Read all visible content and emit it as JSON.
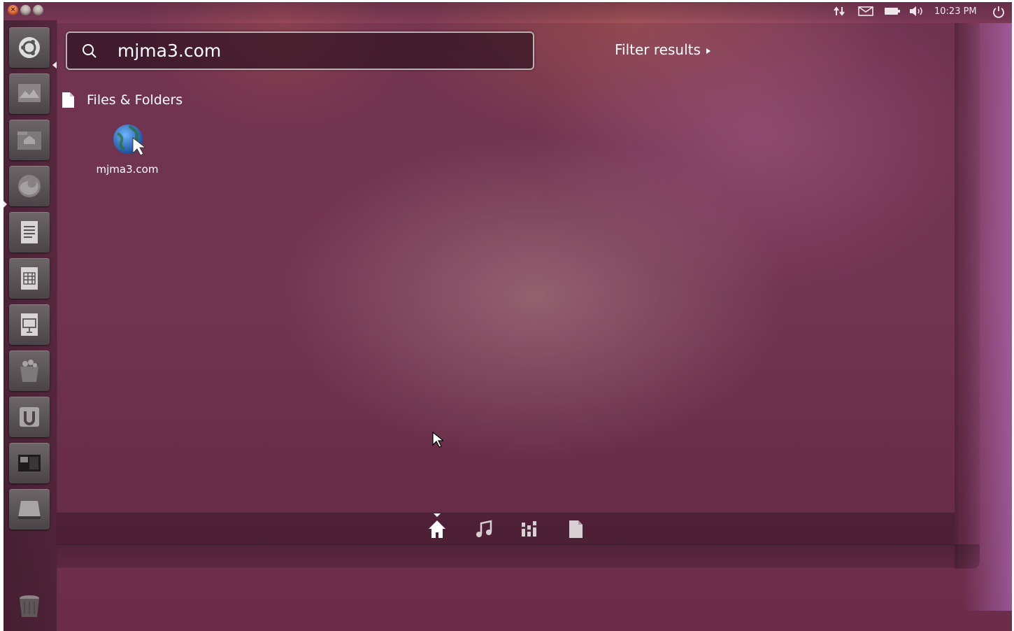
{
  "top_panel": {
    "clock": "10:23 PM",
    "indicators": [
      "network-icon",
      "mail-icon",
      "battery-icon",
      "volume-icon",
      "session-icon"
    ],
    "window_buttons": [
      "close-icon",
      "minimize-icon",
      "maximize-icon"
    ]
  },
  "launcher": {
    "items": [
      {
        "name": "dash-home",
        "icon": "ubuntu-logo-icon"
      },
      {
        "name": "workspace-switcher",
        "icon": "workspaces-icon"
      },
      {
        "name": "home-folder",
        "icon": "home-folder-icon"
      },
      {
        "name": "firefox",
        "icon": "firefox-icon"
      },
      {
        "name": "libreoffice-writer",
        "icon": "writer-icon"
      },
      {
        "name": "libreoffice-calc",
        "icon": "calc-icon"
      },
      {
        "name": "libreoffice-impress",
        "icon": "impress-icon"
      },
      {
        "name": "software-center",
        "icon": "software-center-icon"
      },
      {
        "name": "ubuntu-one",
        "icon": "ubuntu-one-icon"
      },
      {
        "name": "system-settings",
        "icon": "settings-icon"
      },
      {
        "name": "drive",
        "icon": "drive-icon"
      },
      {
        "name": "trash",
        "icon": "trash-icon"
      }
    ]
  },
  "dash": {
    "search": {
      "value": "mjma3.com",
      "placeholder": ""
    },
    "filter_label": "Filter results",
    "category": {
      "title": "Files & Folders",
      "icon": "file-icon"
    },
    "results": [
      {
        "label": "mjma3.com",
        "icon": "web-link-icon"
      }
    ],
    "lenses": [
      {
        "name": "home",
        "icon": "home-lens-icon",
        "active": true
      },
      {
        "name": "music",
        "icon": "music-lens-icon",
        "active": false
      },
      {
        "name": "applications",
        "icon": "apps-lens-icon",
        "active": false
      },
      {
        "name": "files",
        "icon": "files-lens-icon",
        "active": false
      }
    ]
  },
  "colors": {
    "panel_text": "#efe6ea",
    "close_button": "#e5501e",
    "wallpaper_base": "#7a3856"
  }
}
